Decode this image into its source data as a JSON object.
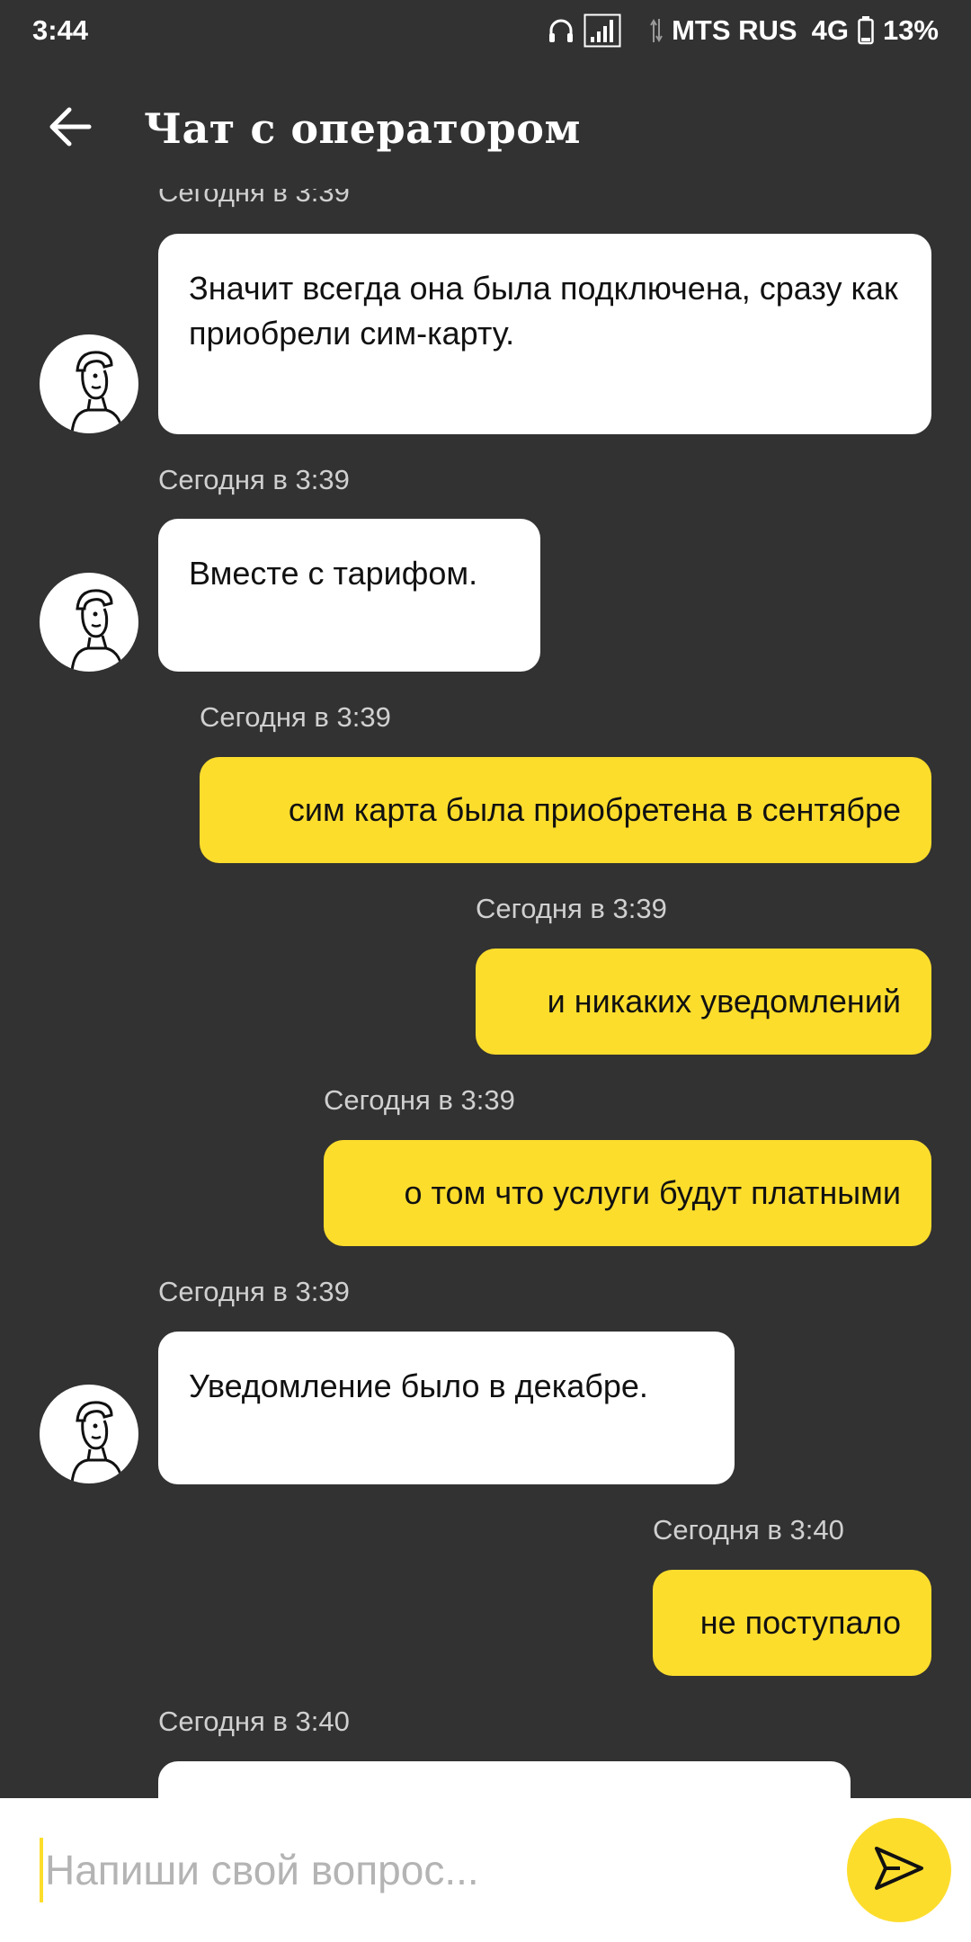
{
  "status": {
    "time": "3:44",
    "carrier": "MTS RUS",
    "network": "4G",
    "battery": "13%"
  },
  "header": {
    "title": "Чат с оператором"
  },
  "messages": [
    {
      "from": "operator",
      "time": "Сегодня в 3:39",
      "text": "Значит всегда она была подключена, сразу как приобрели сим-карту."
    },
    {
      "from": "operator",
      "time": "Сегодня в 3:39",
      "text": "Вместе с тарифом."
    },
    {
      "from": "user",
      "time": "Сегодня в 3:39",
      "text": "сим карта была приобретена в сентябре"
    },
    {
      "from": "user",
      "time": "Сегодня в 3:39",
      "text": "и никаких уведомлений"
    },
    {
      "from": "user",
      "time": "Сегодня в 3:39",
      "text": "о том что услуги будут платными"
    },
    {
      "from": "operator",
      "time": "Сегодня в 3:39",
      "text": "Уведомление было в декабре."
    },
    {
      "from": "user",
      "time": "Сегодня в 3:40",
      "text": "не поступало"
    },
    {
      "from": "operator",
      "time": "Сегодня в 3:40",
      "text": ""
    }
  ],
  "composer": {
    "placeholder": "Напиши свой вопрос..."
  },
  "colors": {
    "background": "#323232",
    "user_bubble": "#fddd2c",
    "operator_bubble": "#ffffff"
  },
  "icons": [
    "headphones-icon",
    "signal-icon",
    "data-arrows-icon",
    "battery-icon",
    "back-arrow-icon",
    "operator-avatar-icon",
    "send-icon"
  ]
}
